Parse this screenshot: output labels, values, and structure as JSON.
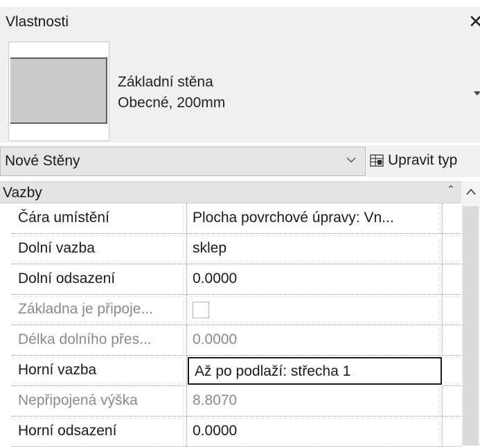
{
  "window": {
    "title": "Vlastnosti",
    "close_icon": "close-icon"
  },
  "type_selector": {
    "family": "Základní stěna",
    "type": "Obecné, 200mm"
  },
  "filter": {
    "selected": "Nové Stěny",
    "edit_type_label": "Upravit typ"
  },
  "group": {
    "label": "Vazby"
  },
  "properties": [
    {
      "name": "Čára umístění",
      "value": "Plocha povrchové úpravy: Vn..."
    },
    {
      "name": "Dolní vazba",
      "value": "sklep"
    },
    {
      "name": "Dolní odsazení",
      "value": "0.0000"
    },
    {
      "name": "Základna je připoje...",
      "value": "",
      "checked": false
    },
    {
      "name": "Délka dolního přes...",
      "value": "0.0000"
    },
    {
      "name": "Horní vazba",
      "value": "Až po podlaží: střecha 1"
    },
    {
      "name": "Nepřipojená výška",
      "value": "8.8070"
    },
    {
      "name": "Horní odsazení",
      "value": "0.0000"
    }
  ],
  "colors": {
    "panel_bg": "#f0f0f0",
    "disabled_text": "#8a8a8a",
    "wall_fill": "#c9c9c9"
  }
}
